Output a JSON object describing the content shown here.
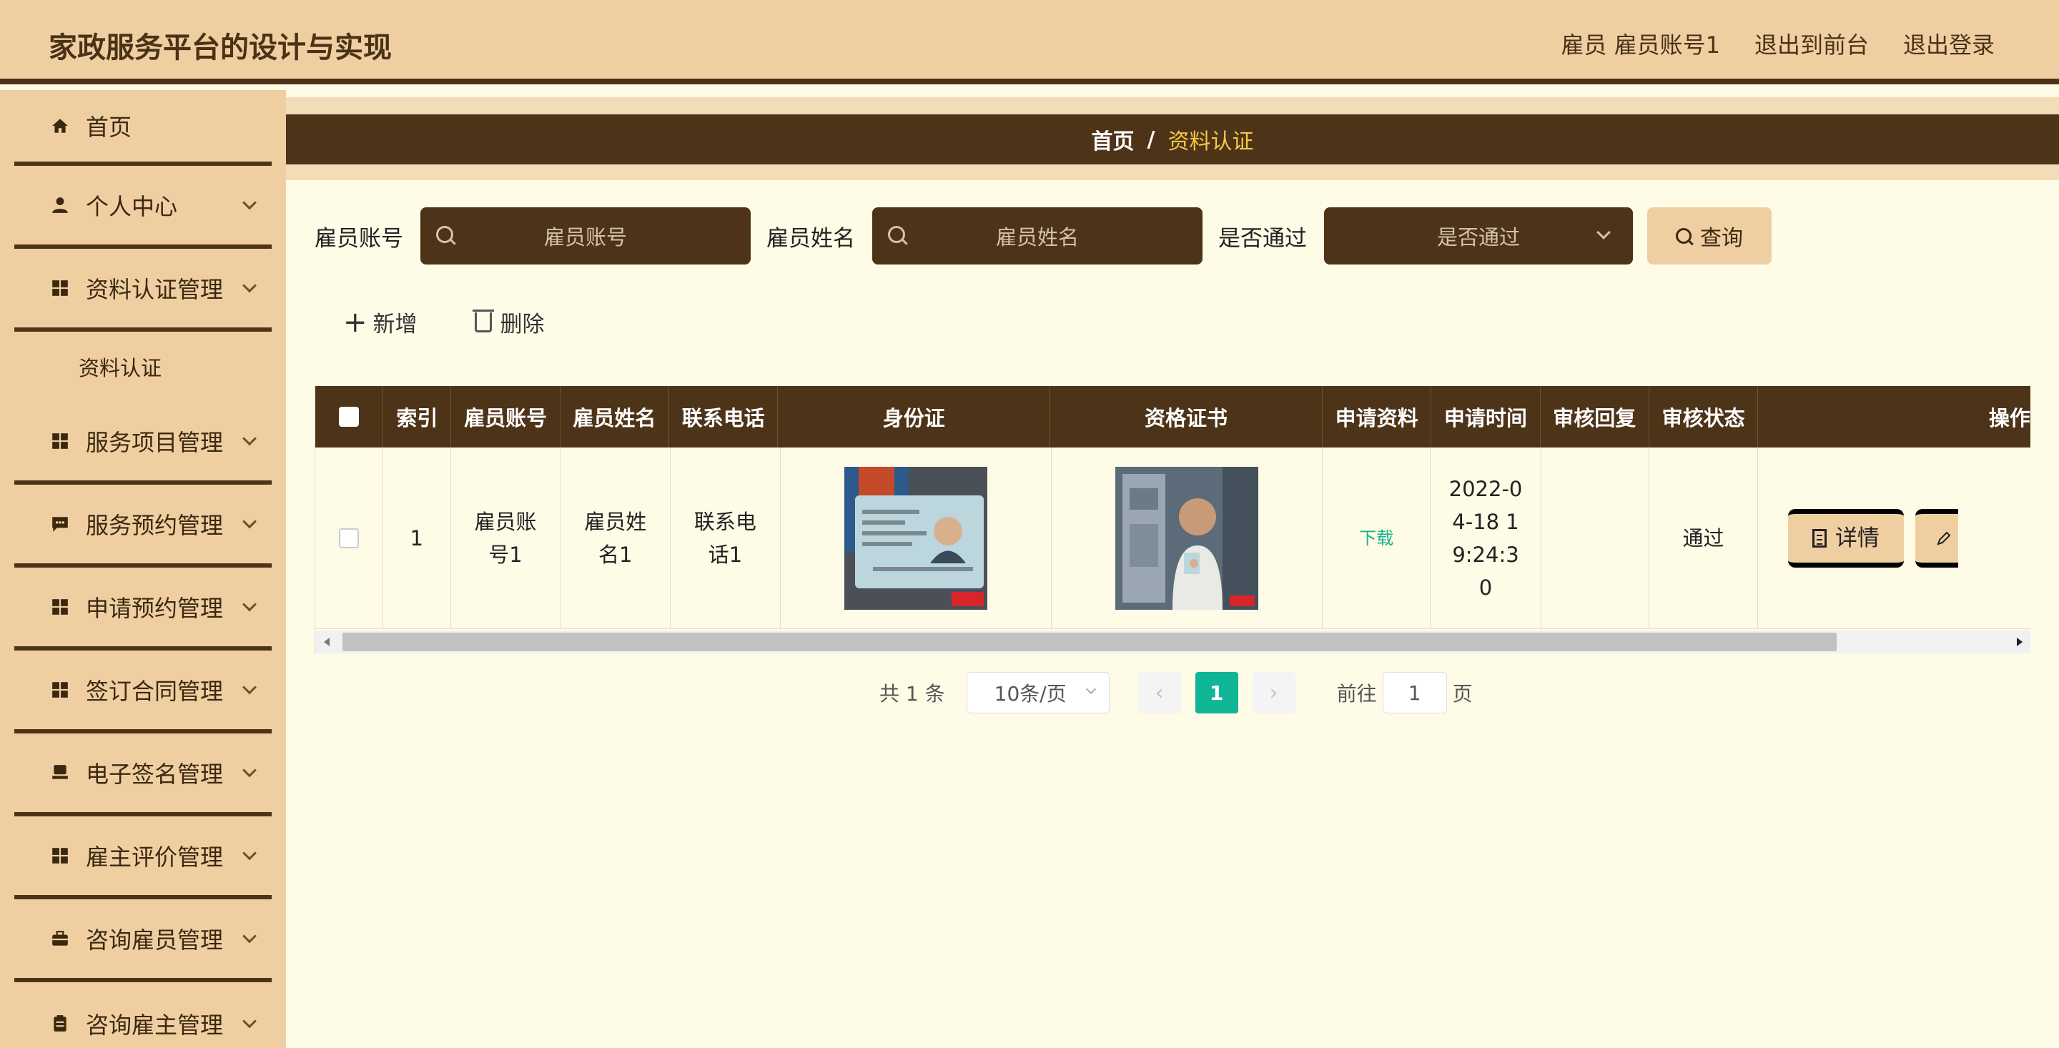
{
  "header": {
    "title": "家政服务平台的设计与实现",
    "user": "雇员 雇员账号1",
    "to_front": "退出到前台",
    "logout": "退出登录"
  },
  "sidebar": {
    "items": [
      {
        "label": "首页",
        "icon": "home-icon"
      },
      {
        "label": "个人中心",
        "icon": "user-icon"
      },
      {
        "label": "资料认证管理",
        "icon": "grid-icon"
      },
      {
        "label": "资料认证",
        "icon": ""
      },
      {
        "label": "服务项目管理",
        "icon": "grid-icon"
      },
      {
        "label": "服务预约管理",
        "icon": "chat-icon"
      },
      {
        "label": "申请预约管理",
        "icon": "grid-icon"
      },
      {
        "label": "签订合同管理",
        "icon": "grid-icon"
      },
      {
        "label": "电子签名管理",
        "icon": "stamp-icon"
      },
      {
        "label": "雇主评价管理",
        "icon": "grid-icon"
      },
      {
        "label": "咨询雇员管理",
        "icon": "briefcase-icon"
      },
      {
        "label": "咨询雇主管理",
        "icon": "clipboard-icon"
      }
    ]
  },
  "breadcrumb": {
    "home": "首页",
    "sep": "/",
    "current": "资料认证"
  },
  "search": {
    "account_label": "雇员账号",
    "account_placeholder": "雇员账号",
    "name_label": "雇员姓名",
    "name_placeholder": "雇员姓名",
    "pass_label": "是否通过",
    "pass_placeholder": "是否通过",
    "query_label": "查询"
  },
  "actions": {
    "add": "新增",
    "delete": "删除"
  },
  "table": {
    "headers": [
      "索引",
      "雇员账号",
      "雇员姓名",
      "联系电话",
      "身份证",
      "资格证书",
      "申请资料",
      "申请时间",
      "审核回复",
      "审核状态",
      "操作"
    ],
    "rows": [
      {
        "index": "1",
        "account": "雇员账号1",
        "name": "雇员姓名1",
        "phone": "联系电话1",
        "material": "下载",
        "time": "2022-04-18 19:24:30",
        "reply": "",
        "status": "通过",
        "detail_label": "详情"
      }
    ]
  },
  "pagination": {
    "total": "共 1 条",
    "page_size": "10条/页",
    "current": "1",
    "goto_prefix": "前往",
    "goto_value": "1",
    "goto_suffix": "页"
  },
  "colors": {
    "header_bg": "#efcfa2",
    "dark_brown": "#4d3318",
    "page_bg": "#fefbe6",
    "accent_green": "#10b596",
    "breadcrumb_active": "#f5c84a"
  }
}
